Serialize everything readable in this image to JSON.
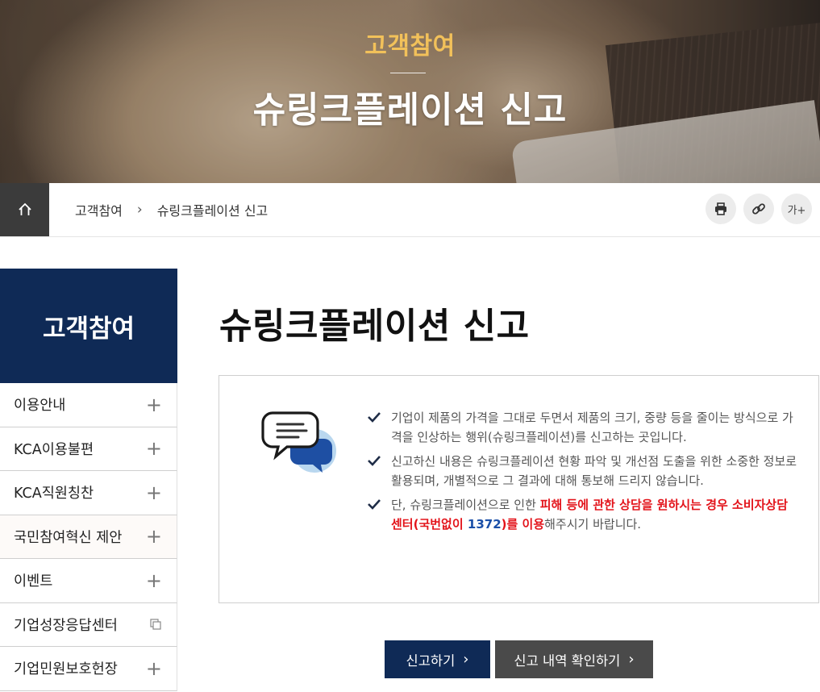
{
  "hero": {
    "subtitle": "고객참여",
    "title": "슈링크플레이션 신고"
  },
  "breadcrumb": {
    "home_icon": "home-icon",
    "items": [
      "고객참여",
      "슈링크플레이션 신고"
    ],
    "separator": "›"
  },
  "tools": {
    "print_icon": "print-icon",
    "link_icon": "link-icon",
    "font_size_label": "가+"
  },
  "sidebar": {
    "title": "고객참여",
    "items": [
      {
        "label": "이용안내",
        "icon": "plus"
      },
      {
        "label": "KCA이용불편",
        "icon": "plus"
      },
      {
        "label": "KCA직원칭찬",
        "icon": "plus"
      },
      {
        "label": "국민참여혁신 제안",
        "icon": "plus"
      },
      {
        "label": "이벤트",
        "icon": "plus"
      },
      {
        "label": "기업성장응답센터",
        "icon": "new-window"
      },
      {
        "label": "기업민원보호헌장",
        "icon": "plus"
      }
    ]
  },
  "main": {
    "title": "슈링크플레이션 신고",
    "notes": [
      {
        "text": "기업이 제품의 가격을 그대로 두면서 제품의 크기, 중량 등을 줄이는 방식으로 가격을 인상하는 행위(슈링크플레이션)를 신고하는 곳입니다."
      },
      {
        "text": "신고하신 내용은 슈링크플레이션 현황 파악 및 개선점 도출을 위한 소중한 정보로 활용되며, 개별적으로 그 결과에 대해 통보해 드리지 않습니다."
      },
      {
        "prefix": "단, 슈링크플레이션으로 인한 ",
        "red1": "피해 등에 관한 상담을 원하시는 경우 소비자상담센터(국번없이 ",
        "blue": "1372",
        "red2": ")를 이용",
        "suffix": "해주시기 바랍니다."
      }
    ],
    "buttons": {
      "report": "신고하기",
      "history": "신고 내역 확인하기",
      "arrow": "›"
    }
  },
  "colors": {
    "navy": "#0f2a56",
    "gold": "#f2c15a",
    "red": "#e3141b",
    "blue": "#1a4fa8",
    "dark_gray": "#4a4a4a"
  }
}
